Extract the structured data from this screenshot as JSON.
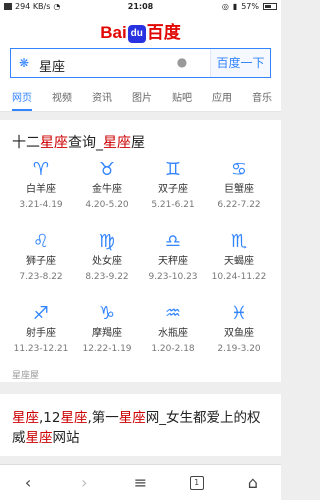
{
  "status_bar": {
    "network": "294 KB/s",
    "time": "21:08",
    "battery": "57%"
  },
  "logo": {
    "bai": "Bai",
    "paw": "du",
    "cn": "百度"
  },
  "search": {
    "query": "星座",
    "button": "百度一下"
  },
  "tabs": [
    "网页",
    "视频",
    "资讯",
    "图片",
    "贴吧",
    "应用",
    "音乐"
  ],
  "result1": {
    "title_a": "十二",
    "title_b": "星座",
    "title_c": "查询_",
    "title_d": "星座",
    "title_e": "屋",
    "signs": [
      {
        "symbol": "♈",
        "name": "白羊座",
        "date": "3.21-4.19"
      },
      {
        "symbol": "♉",
        "name": "金牛座",
        "date": "4.20-5.20"
      },
      {
        "symbol": "♊",
        "name": "双子座",
        "date": "5.21-6.21"
      },
      {
        "symbol": "♋",
        "name": "巨蟹座",
        "date": "6.22-7.22"
      },
      {
        "symbol": "♌",
        "name": "狮子座",
        "date": "7.23-8.22"
      },
      {
        "symbol": "♍",
        "name": "处女座",
        "date": "8.23-9.22"
      },
      {
        "symbol": "♎",
        "name": "天秤座",
        "date": "9.23-10.23"
      },
      {
        "symbol": "♏",
        "name": "天蝎座",
        "date": "10.24-11.22"
      },
      {
        "symbol": "♐",
        "name": "射手座",
        "date": "11.23-12.21"
      },
      {
        "symbol": "♑",
        "name": "摩羯座",
        "date": "12.22-1.19"
      },
      {
        "symbol": "♒",
        "name": "水瓶座",
        "date": "1.20-2.18"
      },
      {
        "symbol": "♓",
        "name": "双鱼座",
        "date": "2.19-3.20"
      }
    ],
    "source": "星座屋"
  },
  "result2": {
    "t1": "星座",
    "t2": ",12",
    "t3": "星座",
    "t4": ",第一",
    "t5": "星座",
    "t6": "网_女生都爱上的权威",
    "t7": "星座",
    "t8": "网站"
  },
  "navbar": {
    "back": "‹",
    "forward": "›",
    "menu": "≡",
    "tab_count": "1",
    "home": "⌂"
  }
}
